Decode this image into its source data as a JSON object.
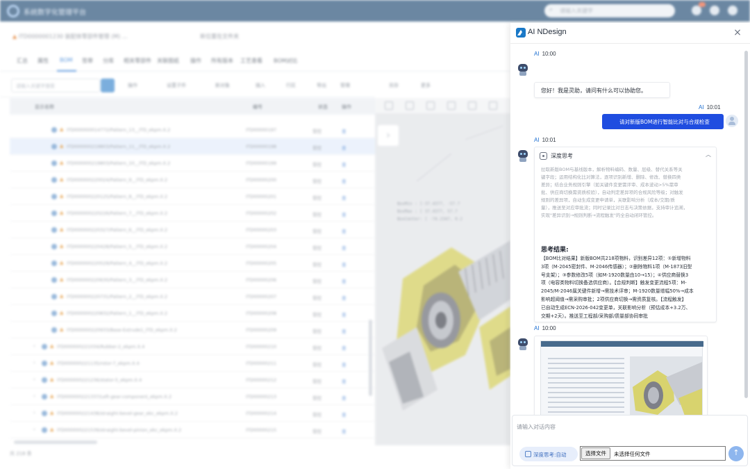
{
  "background_app": {
    "app_title": "系统数字化管理平台",
    "search_placeholder": "请输入关键字",
    "breadcrumb": "ITD0000001230 装配体零部件管理 (M) ... ",
    "breadcrumb_right": "新位置在文件夹",
    "tabs": [
      "汇总",
      "属性",
      "BOM",
      "签审",
      "分库",
      "相关零部件",
      "关联图纸",
      "操作",
      "所有版本",
      "工艺查看",
      "BOM对比"
    ],
    "toolbar": {
      "search_placeholder": "请输入关键字搜索",
      "items": [
        "操作",
        "设置子件",
        "新对象",
        "插入",
        "行区",
        "导出",
        "管理",
        "另存",
        "更多"
      ]
    },
    "grid_headers": [
      "显示名称",
      "编号",
      "状态",
      "操作"
    ],
    "rows": [
      {
        "name": "ITD000000014772/Pattern_13__ITD_ekpm.X.2",
        "code": "ITD00000197",
        "status": "受控",
        "op": "查"
      },
      {
        "name": "ITD000000219803/Pattern_11__ITD_ekpm.X.2",
        "code": "ITD00000198",
        "status": "受控",
        "op": "查"
      },
      {
        "name": "ITD000000219803/Pattern_10__ITD_ekpm.X.2",
        "code": "ITD00000199",
        "status": "受控",
        "op": "查"
      },
      {
        "name": "ITD000000220024/Pattern_9__ITD_ekpm.X.2",
        "code": "ITD00000200",
        "status": "受控",
        "op": "查"
      },
      {
        "name": "ITD000000220125/Pattern_8__ITD_ekpm.X.2",
        "code": "ITD00000201",
        "status": "受控",
        "op": "查"
      },
      {
        "name": "ITD000000220226/Pattern_7__ITD_ekpm.X.2",
        "code": "ITD00000202",
        "status": "受控",
        "op": "查"
      },
      {
        "name": "ITD000000220327/Pattern_6__ITD_ekpm.X.2",
        "code": "ITD00000203",
        "status": "受控",
        "op": "查"
      },
      {
        "name": "ITD000000220428/Pattern_5__ITD_ekpm.X.2",
        "code": "ITD00000204",
        "status": "受控",
        "op": "查"
      },
      {
        "name": "ITD000000220529/Pattern_4__ITD_ekpm.X.2",
        "code": "ITD00000205",
        "status": "受控",
        "op": "查"
      },
      {
        "name": "ITD000000220630/Pattern_3__ITD_ekpm.X.2",
        "code": "ITD00000206",
        "status": "受控",
        "op": "查"
      },
      {
        "name": "ITD000000220731/Pattern_2__ITD_ekpm.X.2",
        "code": "ITD00000207",
        "status": "受控",
        "op": "查"
      },
      {
        "name": "ITD000000220832/Pattern_1__ITD_ekpm.X.2",
        "code": "ITD00000208",
        "status": "受控",
        "op": "查"
      },
      {
        "name": "ITD000000220933/Base-Extrude1_ITD_ekpm.X.2",
        "code": "ITD00000209",
        "status": "受控",
        "op": "查"
      },
      {
        "name": "ITD000000221034/Rubber-2_ekpm.X.4",
        "code": "ITD00000210",
        "status": "受控",
        "op": "查"
      },
      {
        "name": "ITD000000221135/rotor-7_ekpm.X.4",
        "code": "ITD00000211",
        "status": "受控",
        "op": "查"
      },
      {
        "name": "ITD000000221236/stator-5_ekpm.X.4",
        "code": "ITD00000212",
        "status": "受控",
        "op": "查"
      },
      {
        "name": "ITD000000221337/Left-gear-component_ekpm.X.2",
        "code": "ITD00000213",
        "status": "受控",
        "op": "查"
      },
      {
        "name": "ITD000000221438/straight-bevel-gear_ekc_ekpm.X.2",
        "code": "ITD00000214",
        "status": "受控",
        "op": "查"
      },
      {
        "name": "ITD000000221539/straight-bevel-pinion_ekc_ekpm.X.2",
        "code": "ITD00000215",
        "status": "受控",
        "op": "查"
      }
    ],
    "footer": "共 218 条",
    "cad_text": [
      "BoxMin :  [-37.4377, -57.7",
      "BoxMax :  [ 37.4377,  57.7",
      "BoxCenter:  [ -74.2347,  0.2"
    ]
  },
  "chat": {
    "title": "AI NDesign",
    "close_label": "×",
    "ai_name": "AI",
    "messages": [
      {
        "time": "10:00",
        "text": "您好！我是灵助，请问有什么可以协助您。"
      },
      {
        "time": "10:01",
        "text": "请对新版BOM进行智能比对与合规检查"
      },
      {
        "time": "10:01"
      },
      {
        "time": "10:00"
      }
    ],
    "thinking": {
      "title": "深度思考",
      "collapse": "︿",
      "body_lines": [
        "拉取新版BOM与基线版本，解析物料编码、数量、层级、替代关系等关",
        "键字段；运用结构化比对算法，逐项识别新增、删除、修改、替换四类",
        "差异；结合业务规则引擎（如关键件变更需评审、成本波动>5%需审",
        "批、供应商切换需资质校验），自动判定差异项的合规风险等级；对触发",
        "规则的差异项，自动生成变更申请单，关联影响分析（成本/交期/质",
        "量），推送至对应审批流；同时记录比对日志与决策依据，支持审计追溯，",
        "实现\"差异识别→规则判断→流程触发\"的全自动闭环管控。"
      ],
      "result_title": "思考结果:",
      "result_lines": [
        "【BOM比对结果】新版BOM共218项物料，识别差异12项：①新增物料",
        "3项（M-2045密封件、M-2046传感器）；②删除物料1项（M-1873旧型",
        "号支架）；③参数修改5项（如M-1920数量由10→15）；④供应商替换3",
        "项（电容类物料切换备选供应商）。【合规判断】触发变更流程5项：M-",
        "2045/M-2046属关键件新增→需技术评审；M-1920数量增幅50%→成本",
        "影响超阈值→需采购审批；2项供应商切换→需资质复核。【流程触发】",
        "已自动生成ECN-2026-042变更单，关联影响分析（预估成本+3.2万、",
        "交期+2天）。推送至工程部/采购部/质量部协同审批"
      ]
    },
    "composer": {
      "placeholder": "请输入对话内容",
      "deep_think_label": "深度思考:自动",
      "file_button": "选择文件",
      "file_status": "未选择任何文件",
      "send_icon": "↑"
    }
  },
  "colors": {
    "topbar": "#476a8c",
    "accent": "#1d6fd1",
    "user_bubble": "#1f4de0",
    "warning_icon": "#e39a3f"
  }
}
